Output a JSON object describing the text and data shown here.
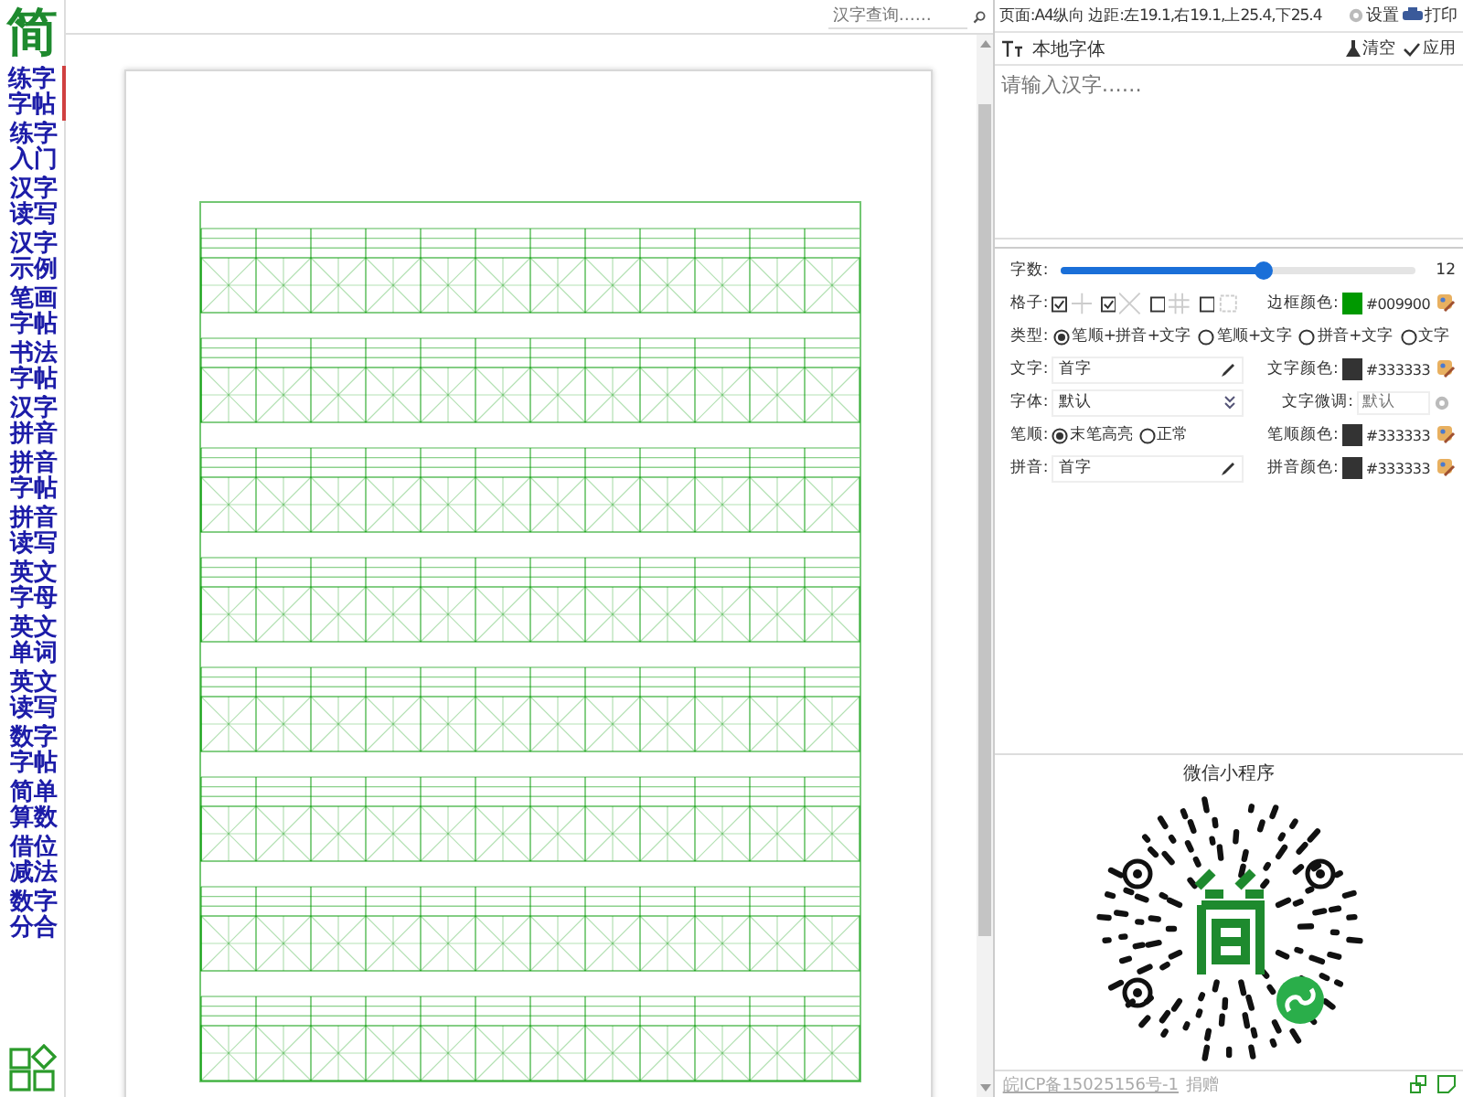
{
  "sidebar": {
    "logo": "简",
    "items": [
      {
        "label": "练字字帖",
        "selected": true
      },
      {
        "label": "练字入门",
        "selected": false
      },
      {
        "label": "汉字读写",
        "selected": false
      },
      {
        "label": "汉字示例",
        "selected": false
      },
      {
        "label": "笔画字帖",
        "selected": false
      },
      {
        "label": "书法字帖",
        "selected": false
      },
      {
        "label": "汉字拼音",
        "selected": false
      },
      {
        "label": "拼音字帖",
        "selected": false
      },
      {
        "label": "拼音读写",
        "selected": false
      },
      {
        "label": "英文字母",
        "selected": false
      },
      {
        "label": "英文单词",
        "selected": false
      },
      {
        "label": "英文读写",
        "selected": false
      },
      {
        "label": "数字字帖",
        "selected": false
      },
      {
        "label": "简单算数",
        "selected": false
      },
      {
        "label": "借位减法",
        "selected": false
      },
      {
        "label": "数字分合",
        "selected": false
      }
    ]
  },
  "search": {
    "placeholder": "汉字查询……"
  },
  "page_info": "页面:A4纵向 边距:左19.1,右19.1,上25.4,下25.4",
  "top_actions": [
    "设置",
    "打印"
  ],
  "font_bar": {
    "label": "本地字体",
    "actions": [
      "清空",
      "应用"
    ]
  },
  "input": {
    "placeholder": "请输入汉字……"
  },
  "settings": {
    "count": {
      "label": "字数:",
      "level": 0.57,
      "reading": "12"
    },
    "grids": {
      "label": "格子:",
      "options": [
        {
          "kind": "cross",
          "checked": true
        },
        {
          "kind": "diagonal",
          "checked": true
        },
        {
          "kind": "hash",
          "checked": false
        },
        {
          "kind": "dashed",
          "checked": false
        }
      ]
    },
    "border_color": {
      "label": "边框颜色:",
      "value": "#009900"
    },
    "type": {
      "label": "类型:",
      "options": [
        {
          "label": "笔顺+拼音+文字",
          "selected": true
        },
        {
          "label": "笔顺+文字",
          "selected": false
        },
        {
          "label": "拼音+文字",
          "selected": false
        },
        {
          "label": "文字",
          "selected": false
        }
      ]
    },
    "text": {
      "label": "文字:",
      "value": "首字"
    },
    "text_color": {
      "label": "文字颜色:",
      "value": "#333333"
    },
    "font": {
      "label": "字体:",
      "value": "默认"
    },
    "text_adjust": {
      "label": "文字微调:",
      "placeholder": "默认"
    },
    "stroke": {
      "label": "笔顺:",
      "options": [
        {
          "label": "末笔高亮",
          "selected": true
        },
        {
          "label": "正常",
          "selected": false
        }
      ]
    },
    "stroke_color": {
      "label": "笔顺颜色:",
      "value": "#333333"
    },
    "pinyin": {
      "label": "拼音:",
      "value": "首字"
    },
    "pinyin_color": {
      "label": "拼音颜色:",
      "value": "#333333"
    }
  },
  "mini_program": {
    "title": "微信小程序"
  },
  "footer": {
    "icp": "皖ICP备15025156号-1",
    "donate": "捐赠"
  }
}
